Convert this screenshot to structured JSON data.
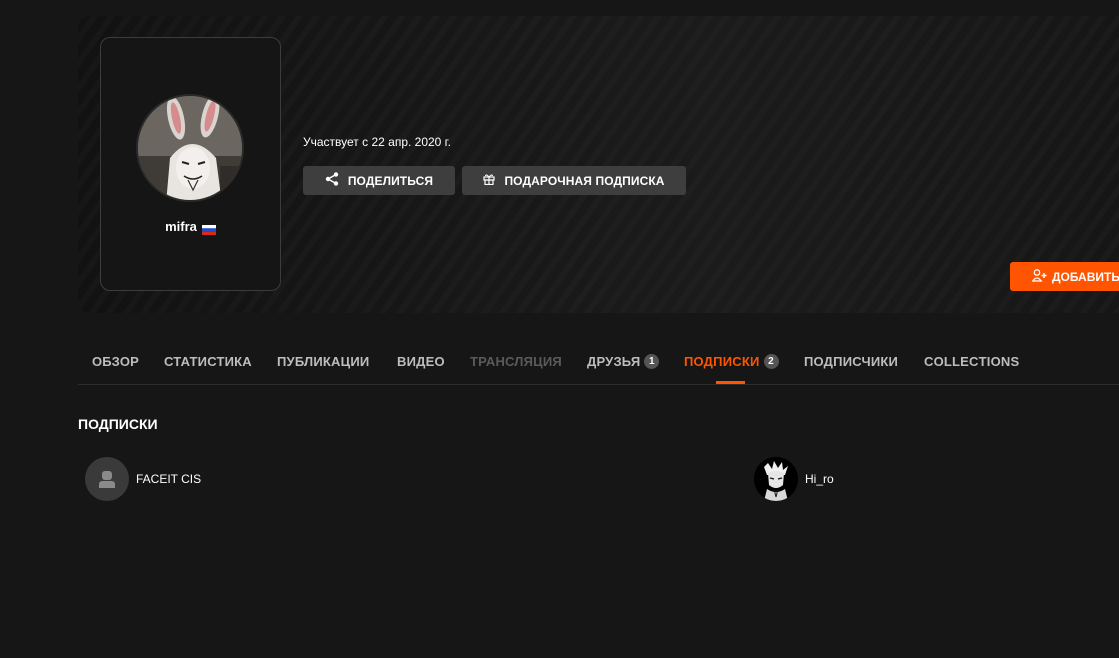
{
  "profile": {
    "nickname": "mifra",
    "member_since": "Участвует с 22 апр. 2020 г.",
    "country_flag_icon": "russia-flag-icon"
  },
  "actions": {
    "share_label": "ПОДЕЛИТЬСЯ",
    "gift_label": "ПОДАРОЧНАЯ ПОДПИСКА",
    "add_friend_label": "ДОБАВИТЬ"
  },
  "tabs": [
    {
      "label": "ОБЗОР",
      "state": "normal"
    },
    {
      "label": "СТАТИСТИКА",
      "state": "normal"
    },
    {
      "label": "ПУБЛИКАЦИИ",
      "state": "normal"
    },
    {
      "label": "ВИДЕО",
      "state": "normal"
    },
    {
      "label": "ТРАНСЛЯЦИЯ",
      "state": "disabled"
    },
    {
      "label": "ДРУЗЬЯ",
      "badge": "1",
      "state": "normal"
    },
    {
      "label": "ПОДПИСКИ",
      "badge": "2",
      "state": "active"
    },
    {
      "label": "ПОДПИСЧИКИ",
      "state": "normal"
    },
    {
      "label": "COLLECTIONS",
      "state": "normal"
    }
  ],
  "subscriptions": {
    "title": "ПОДПИСКИ",
    "items": [
      {
        "name": "FACEIT CIS",
        "avatar_icon": "default-user-icon"
      },
      {
        "name": "Hi_ro",
        "avatar_icon": "anime-character-avatar"
      }
    ]
  },
  "colors": {
    "accent": "#ff5500",
    "background": "#161616",
    "button": "#3e3e3e"
  }
}
